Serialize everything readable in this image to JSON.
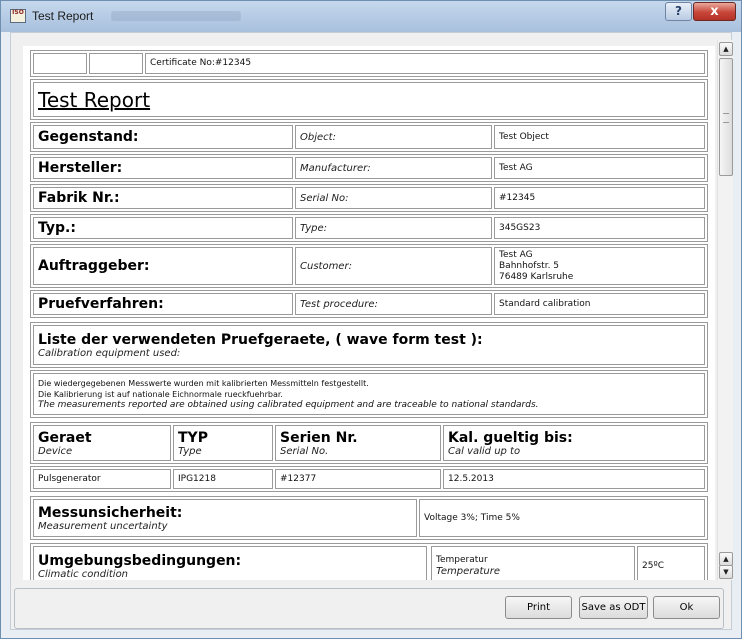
{
  "window": {
    "title": "Test Report",
    "app_icon_text": "ISO"
  },
  "titlebar_buttons": {
    "help": "?",
    "close": "x"
  },
  "certificate": {
    "label": "Certificate No:#12345"
  },
  "report_title": "Test Report",
  "info_rows": [
    {
      "de": "Gegenstand:",
      "en": "Object:",
      "value": "Test Object"
    },
    {
      "de": "Hersteller:",
      "en": "Manufacturer:",
      "value": "Test AG"
    },
    {
      "de": "Fabrik Nr.:",
      "en": "Serial No:",
      "value": "#12345"
    },
    {
      "de": "Typ.:",
      "en": "Type:",
      "value": "345GS23"
    },
    {
      "de": "Auftraggeber:",
      "en": "Customer:",
      "value_lines": [
        "Test AG",
        "Bahnhofstr. 5",
        "76489 Karlsruhe"
      ]
    },
    {
      "de": "Pruefverfahren:",
      "en": "Test procedure:",
      "value": "Standard calibration"
    }
  ],
  "equipment": {
    "title": "Liste der verwendeten Pruefgeraete, ( wave form test ):",
    "subtitle": "Calibration equipment used:",
    "note_line1": "Die wiedergegebenen Messwerte wurden mit kalibrierten Messmitteln festgestellt.",
    "note_line2": "Die Kalibrierung ist auf nationale Eichnormale rueckfuehrbar.",
    "note_line3": "The measurements reported are obtained using calibrated equipment and are traceable to national standards.",
    "headers": [
      {
        "de": "Geraet",
        "en": "Device"
      },
      {
        "de": "TYP",
        "en": "Type"
      },
      {
        "de": "Serien Nr.",
        "en": "Serial No."
      },
      {
        "de": "Kal. gueltig bis:",
        "en": "Cal valid up to"
      }
    ],
    "row": [
      "Pulsgenerator",
      "IPG1218",
      "#12377",
      "12.5.2013"
    ]
  },
  "uncertainty": {
    "de": "Messunsicherheit:",
    "en": "Measurement uncertainty",
    "value": "Voltage 3%; Time 5%"
  },
  "climate": {
    "de": "Umgebungsbedingungen:",
    "en": "Climatic condition",
    "param_de": "Temperatur",
    "param_en": "Temperature",
    "value": "25ºC"
  },
  "buttons": {
    "print": "Print",
    "save_odt": "Save as ODT",
    "ok": "Ok"
  }
}
